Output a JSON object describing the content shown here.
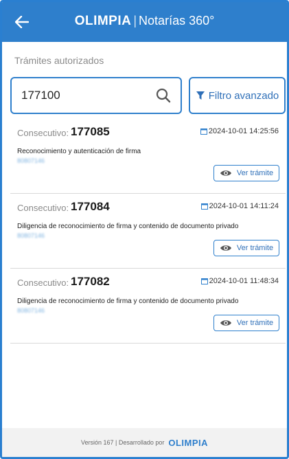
{
  "header": {
    "logo_text": "OLIMPIA",
    "separator": "|",
    "product_name": "Notarías 360°"
  },
  "section_title": "Trámites autorizados",
  "search": {
    "value": "177100"
  },
  "filter_button_label": "Filtro avanzado",
  "consecutive_label": "Consecutivo:",
  "view_button_label": "Ver trámite",
  "records": [
    {
      "number": "177085",
      "datetime": "2024-10-01 14:25:56",
      "description": "Reconocimiento y autenticación de firma",
      "blurred_id": "80807146"
    },
    {
      "number": "177084",
      "datetime": "2024-10-01 14:11:24",
      "description": "Diligencia de reconocimiento de firma y contenido de documento privado",
      "blurred_id": "80807146"
    },
    {
      "number": "177082",
      "datetime": "2024-10-01 11:48:34",
      "description": "Diligencia de reconocimiento de firma y contenido de documento privado",
      "blurred_id": "80807146"
    }
  ],
  "footer": {
    "text": "Versión 167 | Desarrollado por",
    "logo_text": "OLIMPIA"
  },
  "colors": {
    "primary": "#2e7fcc",
    "muted_text": "#8a8a8a"
  },
  "icons": {
    "back": "arrow-left-icon",
    "search": "search-icon",
    "filter": "filter-icon",
    "calendar": "calendar-icon",
    "view": "eye-icon"
  }
}
